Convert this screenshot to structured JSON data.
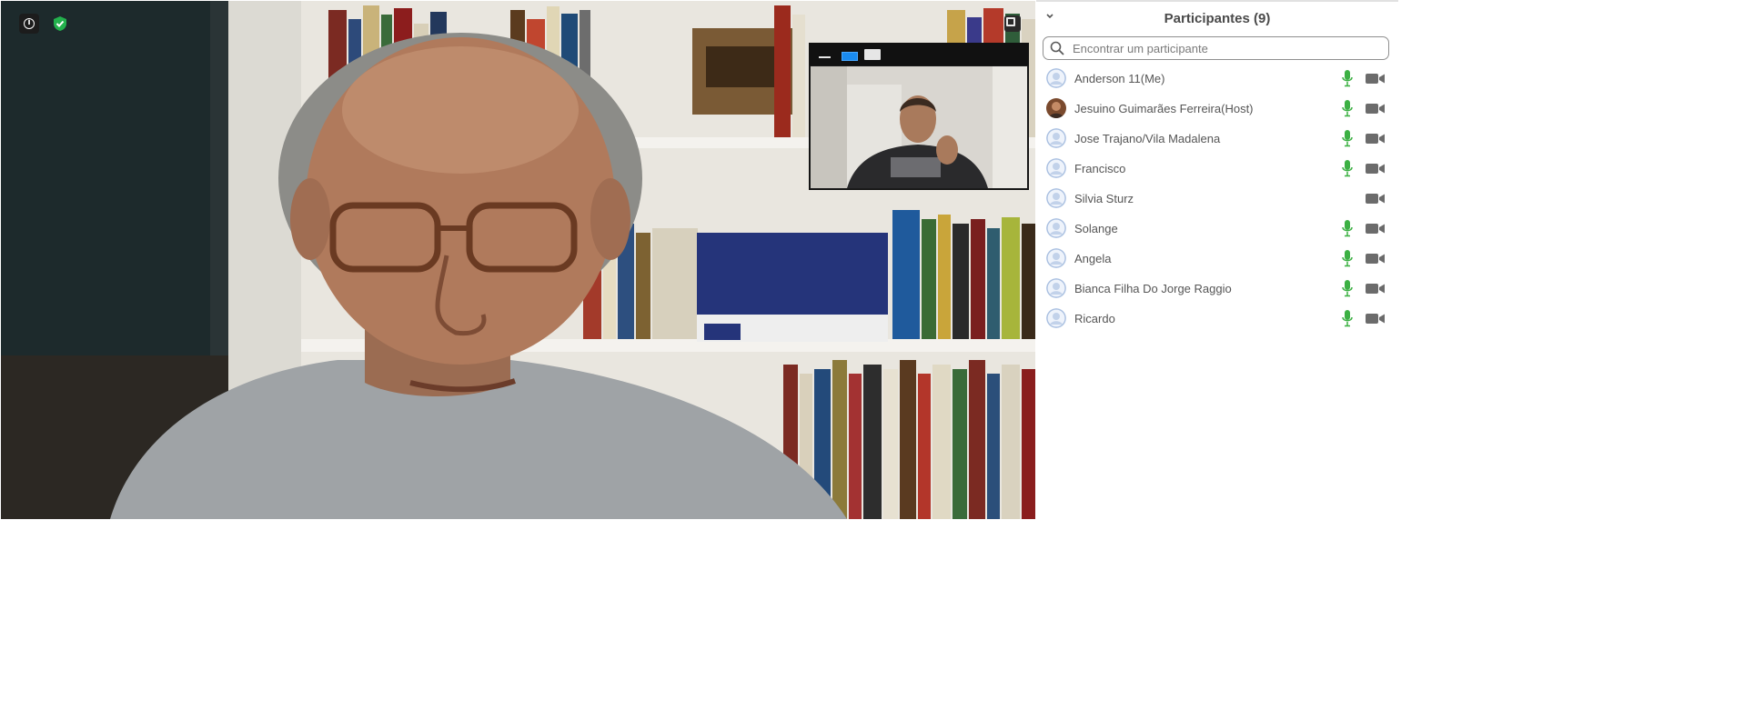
{
  "panel": {
    "title": "Participantes (9)",
    "collapse_icon": "chevron-down-icon",
    "search_placeholder": "Encontrar um participante"
  },
  "video": {
    "info_icon": "info-icon",
    "security_icon": "shield-check-icon",
    "fullscreen_icon": "fullscreen-icon"
  },
  "thumbnail": {
    "controls": [
      "minimize-icon",
      "active-speaker-icon",
      "fullscreen-icon"
    ]
  },
  "participants": [
    {
      "name": "Anderson 11(Me)",
      "mic": true,
      "camera": true,
      "avatar": "default"
    },
    {
      "name": "Jesuino Guimarães Ferreira(Host)",
      "mic": true,
      "camera": true,
      "avatar": "photo"
    },
    {
      "name": "Jose Trajano/Vila Madalena",
      "mic": true,
      "camera": true,
      "avatar": "default"
    },
    {
      "name": "Francisco",
      "mic": true,
      "camera": true,
      "avatar": "default"
    },
    {
      "name": "Silvia Sturz",
      "mic": false,
      "camera": true,
      "avatar": "default"
    },
    {
      "name": "Solange",
      "mic": true,
      "camera": true,
      "avatar": "default"
    },
    {
      "name": "Angela",
      "mic": true,
      "camera": true,
      "avatar": "default"
    },
    {
      "name": "Bianca Filha Do Jorge Raggio",
      "mic": true,
      "camera": true,
      "avatar": "default"
    },
    {
      "name": "Ricardo",
      "mic": true,
      "camera": true,
      "avatar": "default"
    }
  ],
  "colors": {
    "mic_active": "#3cb043",
    "camera": "#6b6b6b",
    "avatar": "#a9bfe0",
    "accent": "#1a8bf0"
  }
}
